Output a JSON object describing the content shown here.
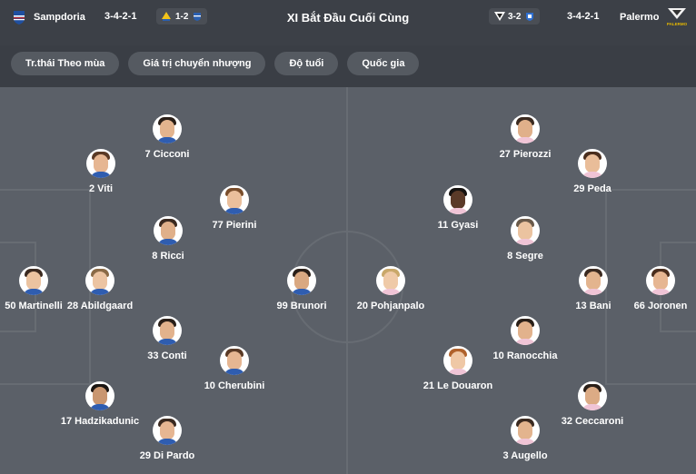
{
  "header": {
    "home_team": "Sampdoria",
    "home_formation": "3-4-2-1",
    "home_score": "1-2",
    "title": "XI Bắt Đầu Cuối Cùng",
    "away_score": "3-2",
    "away_formation": "3-4-2-1",
    "away_team": "Palermo",
    "crest_label": "PALERMO"
  },
  "tabs": [
    {
      "label": "Tr.thái Theo mùa"
    },
    {
      "label": "Giá trị chuyển nhượng"
    },
    {
      "label": "Độ tuổi"
    },
    {
      "label": "Quốc gia"
    }
  ],
  "home_players": [
    {
      "label": "7 Cicconi"
    },
    {
      "label": "2 Viti"
    },
    {
      "label": "77 Pierini"
    },
    {
      "label": "8 Ricci"
    },
    {
      "label": "50 Martinelli"
    },
    {
      "label": "28 Abildgaard"
    },
    {
      "label": "99 Brunori"
    },
    {
      "label": "33 Conti"
    },
    {
      "label": "10 Cherubini"
    },
    {
      "label": "17 Hadzikadunic"
    },
    {
      "label": "29 Di Pardo"
    }
  ],
  "away_players": [
    {
      "label": "27 Pierozzi"
    },
    {
      "label": "29 Peda"
    },
    {
      "label": "11 Gyasi"
    },
    {
      "label": "8 Segre"
    },
    {
      "label": "20 Pohjanpalo"
    },
    {
      "label": "13 Bani"
    },
    {
      "label": "66 Joronen"
    },
    {
      "label": "10 Ranocchia"
    },
    {
      "label": "21 Le Douaron"
    },
    {
      "label": "32 Ceccaroni"
    },
    {
      "label": "3 Augello"
    }
  ],
  "colors": {
    "background": "#3a3e45",
    "pitch": "#5b6068",
    "pitch_lines": "#676c73",
    "tab": "#555a61"
  }
}
